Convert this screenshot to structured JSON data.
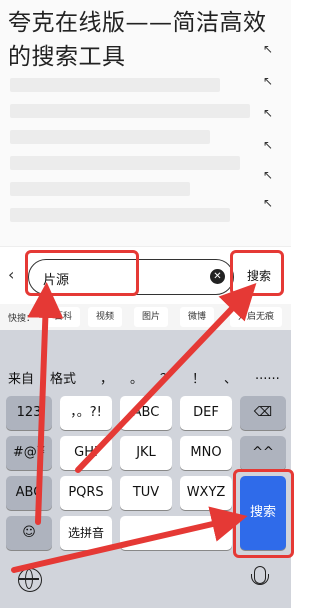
{
  "title": "夸克在线版——简洁高效的搜索工具",
  "search": {
    "back_icon": "chevron-left-icon",
    "input_value": "片源",
    "clear_icon": "clear-icon",
    "submit_label": "搜索"
  },
  "quickbar": {
    "label": "快搜：",
    "pills": [
      "百科",
      "视频",
      "图片",
      "微博",
      "开启无痕"
    ]
  },
  "keyboard": {
    "candidates": [
      "来自",
      "格式",
      "，",
      "。",
      "？",
      "！",
      "、",
      "......"
    ],
    "rows": [
      [
        "123",
        "，。?!",
        "ABC",
        "DEF",
        "⌫"
      ],
      [
        "#@¥",
        "GHI",
        "JKL",
        "MNO",
        "^^"
      ],
      [
        "ABC",
        "PQRS",
        "TUV",
        "WXYZ"
      ],
      [
        "☺",
        "选拼音",
        ""
      ]
    ],
    "enter_label": "搜索",
    "globe_icon": "globe-icon",
    "mic_icon": "microphone-icon"
  },
  "colors": {
    "annotation": "#e53935",
    "enter_key": "#2f6bea"
  }
}
